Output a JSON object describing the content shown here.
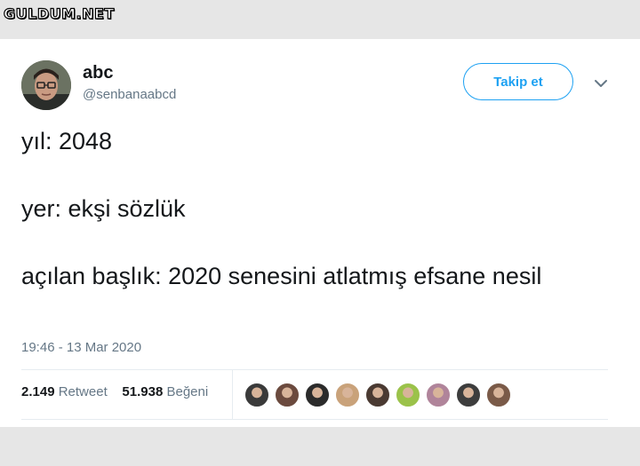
{
  "watermark": "GULDUM.NET",
  "tweet": {
    "author": {
      "name": "abc",
      "handle": "@senbanaabcd",
      "avatar": "profile-photo"
    },
    "follow_label": "Takip et",
    "caret_icon": "chevron-down-icon",
    "lines": [
      "yıl: 2048",
      "yer: ekşi sözlük",
      "açılan başlık: 2020 senesini atlatmış efsane nesil"
    ],
    "timestamp": "19:46 - 13 Mar 2020",
    "retweets": {
      "count": "2.149",
      "label": "Retweet"
    },
    "likes": {
      "count": "51.938",
      "label": "Beğeni"
    },
    "liker_avatars": [
      "#3a3a3a",
      "#6b4a3e",
      "#2b2b2b",
      "#c9a27a",
      "#4a3a32",
      "#9bc24a",
      "#b0849a",
      "#3d3d3d",
      "#7a5a48"
    ]
  },
  "colors": {
    "accent": "#1da1f2",
    "text": "#14171a",
    "muted": "#657786",
    "border": "#e6ecf0"
  }
}
